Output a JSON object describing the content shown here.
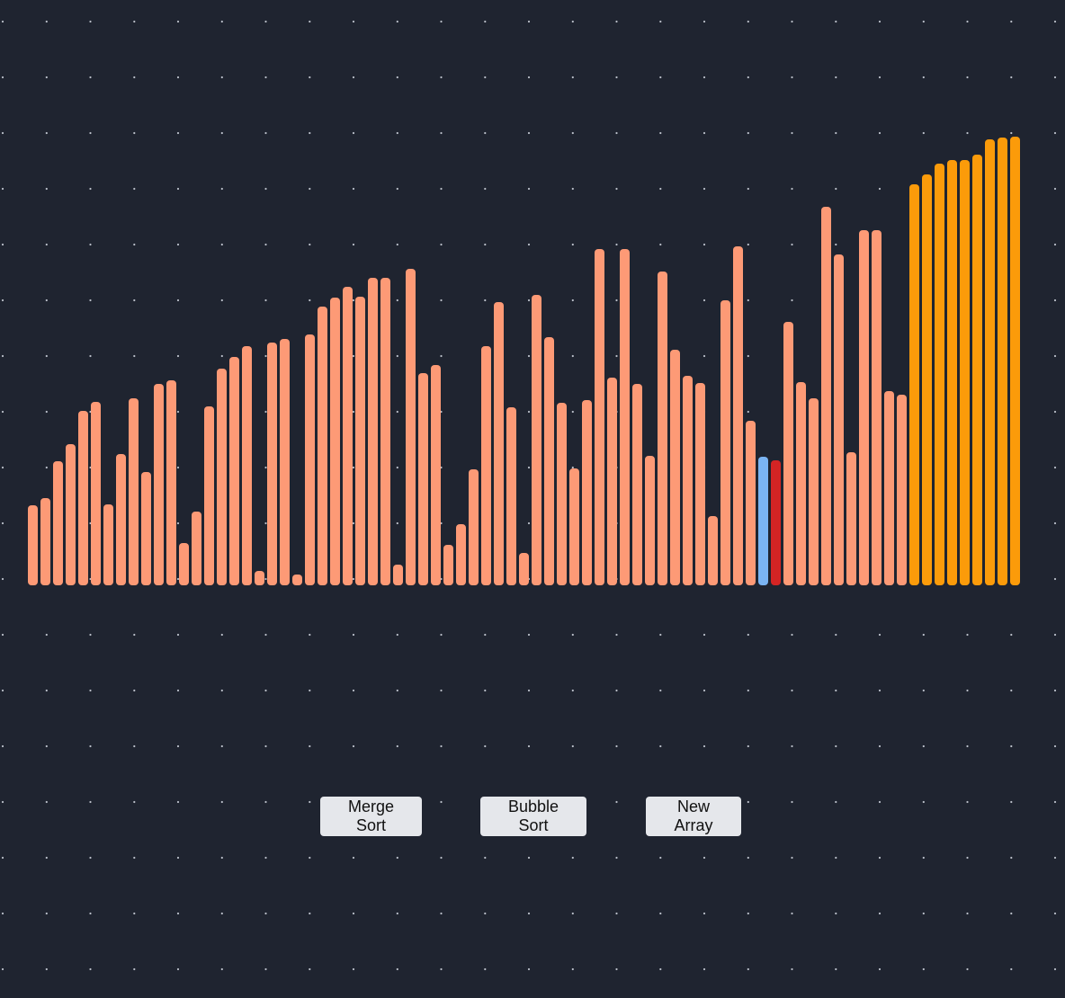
{
  "controls": {
    "merge_sort_label": "Merge Sort",
    "bubble_sort_label": "Bubble Sort",
    "new_array_label": "New Array"
  },
  "colors": {
    "background": "#1f2430",
    "bar_default": "#fd9a76",
    "bar_sorted": "#fb9b0a",
    "bar_compare_a": "#7ab4f2",
    "bar_compare_b": "#d42424",
    "dot": "#d6dbe4"
  },
  "array": {
    "max_value": 500,
    "values": [
      89,
      97,
      138,
      157,
      194,
      204,
      90,
      146,
      208,
      126,
      224,
      228,
      47,
      82,
      199,
      241,
      254,
      266,
      16,
      270,
      274,
      12,
      279,
      310,
      320,
      332,
      321,
      342,
      342,
      23,
      352,
      236,
      245,
      45,
      68,
      129,
      266,
      315,
      198,
      36,
      323,
      276,
      203,
      130,
      206,
      374,
      231,
      374,
      224,
      144,
      349,
      262,
      233,
      225,
      77,
      317,
      377,
      183,
      143,
      139,
      293,
      226,
      208,
      421,
      368,
      148,
      395,
      395,
      216,
      212,
      446,
      457,
      469,
      473,
      473,
      479,
      496,
      498,
      499
    ],
    "states": [
      "default",
      "default",
      "default",
      "default",
      "default",
      "default",
      "default",
      "default",
      "default",
      "default",
      "default",
      "default",
      "default",
      "default",
      "default",
      "default",
      "default",
      "default",
      "default",
      "default",
      "default",
      "default",
      "default",
      "default",
      "default",
      "default",
      "default",
      "default",
      "default",
      "default",
      "default",
      "default",
      "default",
      "default",
      "default",
      "default",
      "default",
      "default",
      "default",
      "default",
      "default",
      "default",
      "default",
      "default",
      "default",
      "default",
      "default",
      "default",
      "default",
      "default",
      "default",
      "default",
      "default",
      "default",
      "default",
      "default",
      "default",
      "default",
      "compare_a",
      "compare_b",
      "default",
      "default",
      "default",
      "default",
      "default",
      "default",
      "default",
      "default",
      "default",
      "default",
      "sorted",
      "sorted",
      "sorted",
      "sorted",
      "sorted",
      "sorted",
      "sorted",
      "sorted",
      "sorted"
    ]
  }
}
